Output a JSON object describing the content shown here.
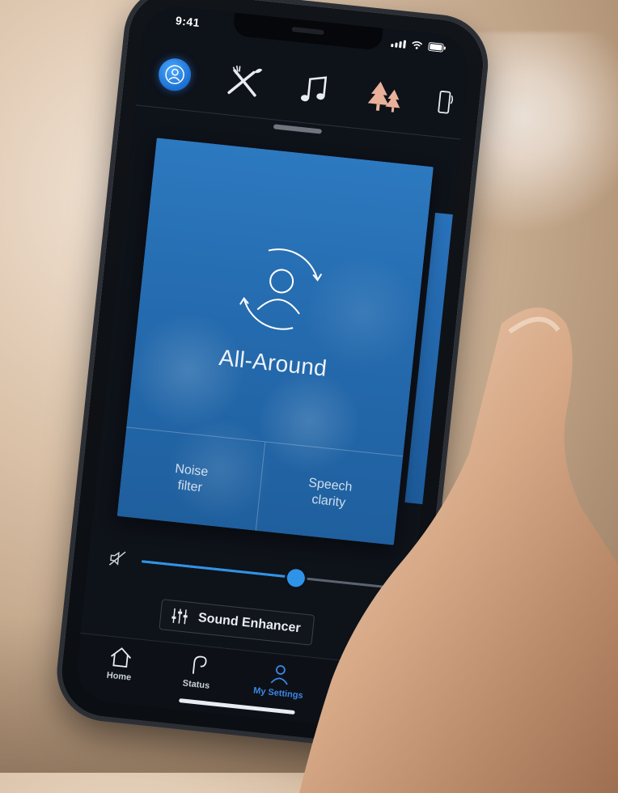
{
  "status_bar": {
    "time": "9:41"
  },
  "programs": [
    {
      "icon": "user-circle-icon",
      "active": true
    },
    {
      "icon": "restaurant-icon",
      "active": false
    },
    {
      "icon": "music-note-icon",
      "active": false
    },
    {
      "icon": "tree-icon",
      "active": false
    }
  ],
  "card": {
    "title": "All-Around",
    "features": [
      "Noise\nfilter",
      "Speech\nclarity"
    ]
  },
  "volume": {
    "level": 0.62
  },
  "sound_enhancer": {
    "label": "Sound Enhancer"
  },
  "tabs": [
    {
      "label": "Home",
      "icon": "home-icon"
    },
    {
      "label": "Status",
      "icon": "hearing-aid-icon"
    },
    {
      "label": "My Settings",
      "icon": "user-icon"
    }
  ],
  "colors": {
    "accent": "#2f93e8",
    "card_blue": "#256cb0",
    "active_tab": "#3b86e6"
  }
}
